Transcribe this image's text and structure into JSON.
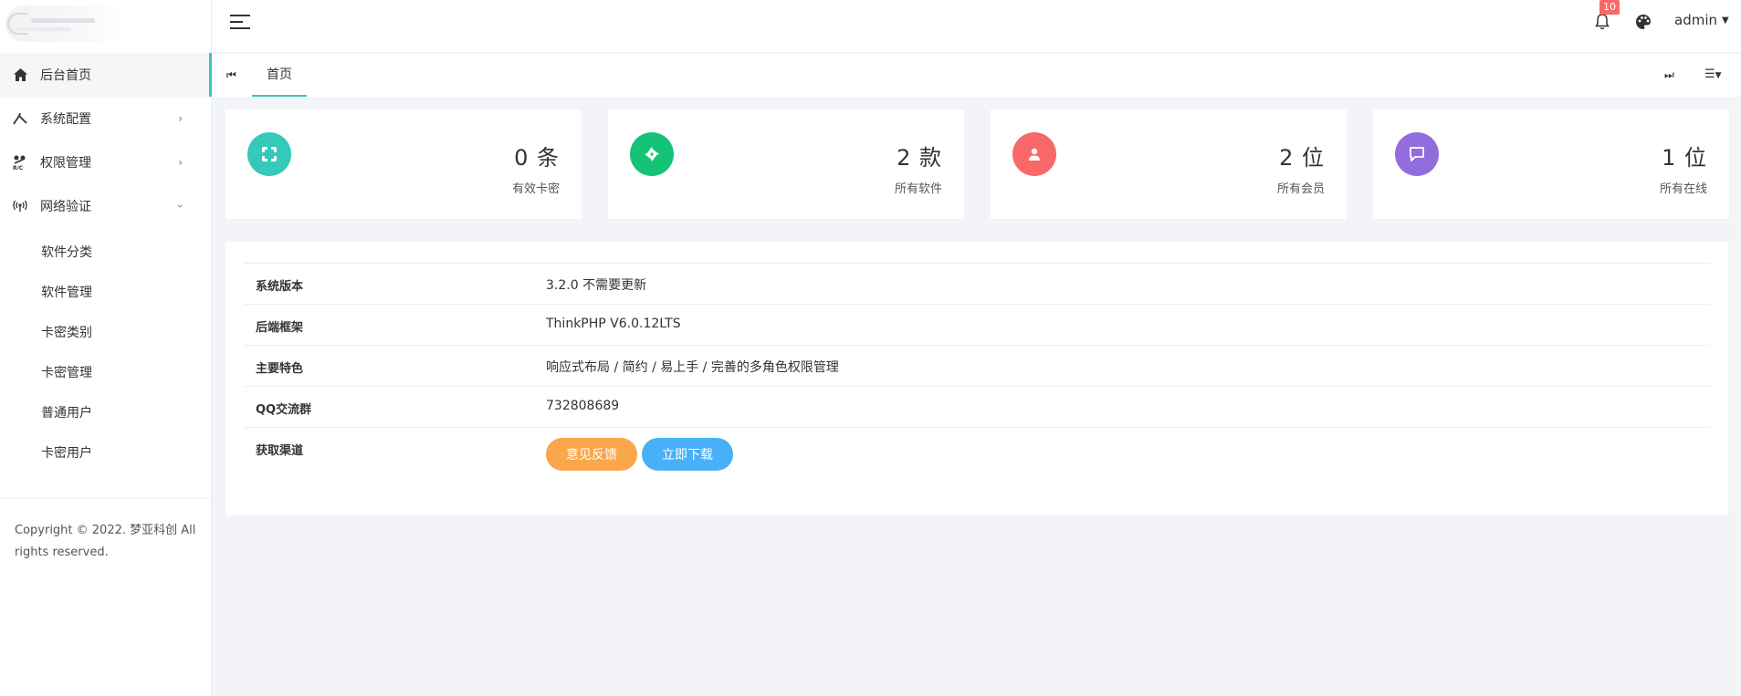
{
  "sidebar": {
    "items": [
      {
        "label": "后台首页",
        "icon": "home-icon"
      },
      {
        "label": "系统配置",
        "icon": "settings-icon"
      },
      {
        "label": "权限管理",
        "icon": "rbac-icon"
      },
      {
        "label": "网络验证",
        "icon": "network-icon"
      }
    ],
    "sub_items": [
      "软件分类",
      "软件管理",
      "卡密类别",
      "卡密管理",
      "普通用户",
      "卡密用户"
    ],
    "copyright": "Copyright © 2022. 梦亚科创 All rights reserved."
  },
  "header": {
    "notification_count": "10",
    "user_name": "admin"
  },
  "tabs": {
    "home": "首页"
  },
  "stats": [
    {
      "value": "0 条",
      "label": "有效卡密",
      "color": "#33cabb",
      "icon": "card-icon"
    },
    {
      "value": "2 款",
      "label": "所有软件",
      "color": "#15c377",
      "icon": "software-icon"
    },
    {
      "value": "2 位",
      "label": "所有会员",
      "color": "#f96868",
      "icon": "member-icon"
    },
    {
      "value": "1 位",
      "label": "所有在线",
      "color": "#926dde",
      "icon": "chat-icon"
    }
  ],
  "info": [
    {
      "key": "系统版本",
      "value": "3.2.0 不需要更新"
    },
    {
      "key": "后端框架",
      "value": "ThinkPHP V6.0.12LTS"
    },
    {
      "key": "主要特色",
      "value": "响应式布局 / 简约 / 易上手 / 完善的多角色权限管理"
    },
    {
      "key": "QQ交流群",
      "value": "732808689"
    },
    {
      "key": "获取渠道",
      "value": ""
    }
  ],
  "buttons": {
    "feedback": "意见反馈",
    "download": "立即下载"
  },
  "colors": {
    "accent": "#33cabb",
    "feedback_button": "#faa64b",
    "download_button": "#48b0f7",
    "badge": "#f96868"
  }
}
